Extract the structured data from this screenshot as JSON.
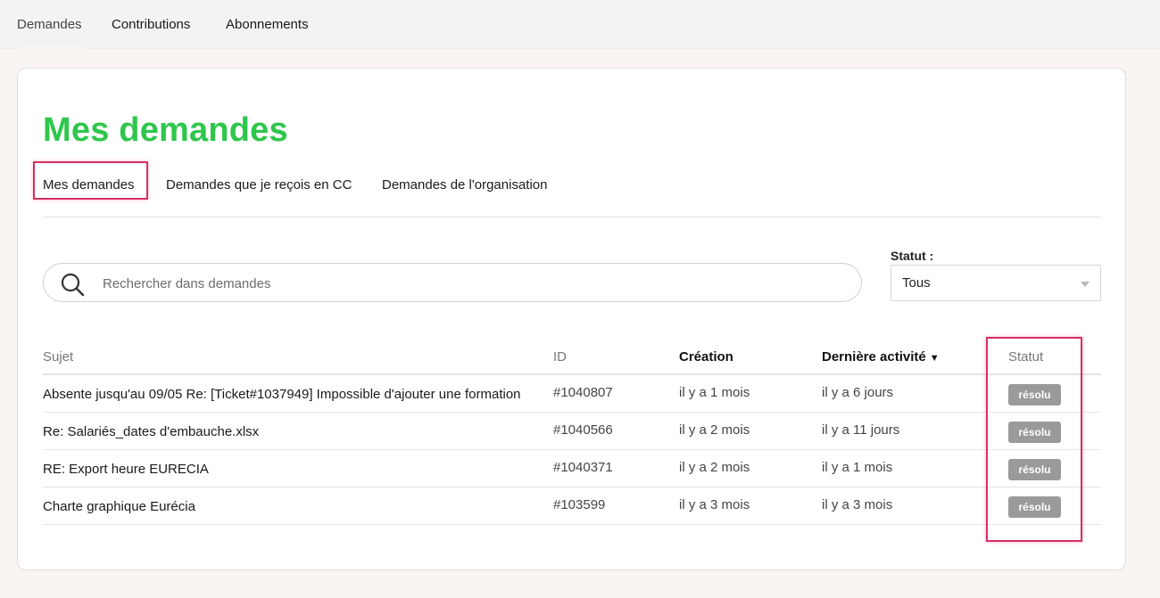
{
  "topnav": {
    "items": [
      {
        "label": "Demandes"
      },
      {
        "label": "Contributions"
      },
      {
        "label": "Abonnements"
      }
    ]
  },
  "page": {
    "title": "Mes demandes"
  },
  "subtabs": [
    {
      "label": "Mes demandes"
    },
    {
      "label": "Demandes que je reçois en CC"
    },
    {
      "label": "Demandes de l'organisation"
    }
  ],
  "search": {
    "placeholder": "Rechercher dans demandes",
    "value": ""
  },
  "status_filter": {
    "label": "Statut :",
    "selected": "Tous"
  },
  "table": {
    "columns": {
      "subject": "Sujet",
      "id": "ID",
      "created": "Création",
      "activity": "Dernière activité",
      "status": "Statut"
    },
    "sort_indicator": "▼",
    "rows": [
      {
        "subject": "Absente jusqu'au 09/05 Re: [Ticket#1037949] Impossible d'ajouter une formation",
        "id": "#1040807",
        "created": "il y a 1 mois",
        "activity": "il y a 6 jours",
        "status": "résolu"
      },
      {
        "subject": "Re: Salariés_dates d'embauche.xlsx",
        "id": "#1040566",
        "created": "il y a 2 mois",
        "activity": "il y a 11 jours",
        "status": "résolu"
      },
      {
        "subject": "RE: Export heure EURECIA",
        "id": "#1040371",
        "created": "il y a 2 mois",
        "activity": "il y a 1 mois",
        "status": "résolu"
      },
      {
        "subject": "Charte graphique Eurécia",
        "id": "#103599",
        "created": "il y a 3 mois",
        "activity": "il y a 3 mois",
        "status": "résolu"
      }
    ]
  },
  "colors": {
    "title_green": "#2ec64b",
    "highlight": "#d63063",
    "badge_gray": "#9a9a9a"
  }
}
